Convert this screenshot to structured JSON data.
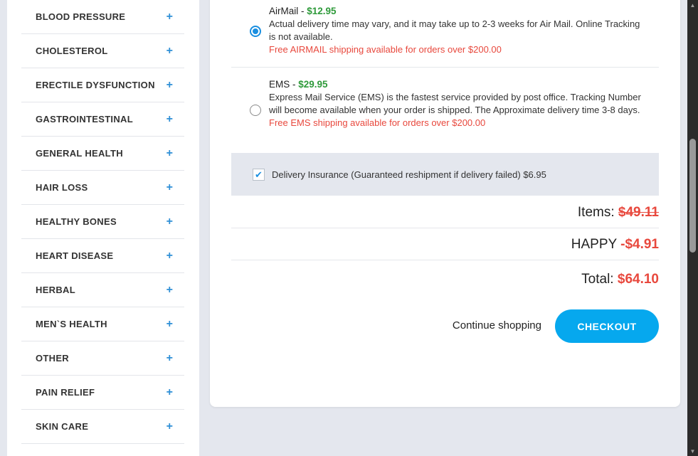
{
  "sidebar": {
    "categories": [
      {
        "label": "BLOOD PRESSURE"
      },
      {
        "label": "CHOLESTEROL"
      },
      {
        "label": "ERECTILE DYSFUNCTION"
      },
      {
        "label": "GASTROINTESTINAL"
      },
      {
        "label": "GENERAL HEALTH"
      },
      {
        "label": "HAIR LOSS"
      },
      {
        "label": "HEALTHY BONES"
      },
      {
        "label": "HEART DISEASE"
      },
      {
        "label": "HERBAL"
      },
      {
        "label": "MEN`S HEALTH"
      },
      {
        "label": "OTHER"
      },
      {
        "label": "PAIN RELIEF"
      },
      {
        "label": "SKIN CARE"
      }
    ],
    "expand_icon": "+"
  },
  "shipping": {
    "airmail": {
      "name": "AirMail",
      "separator": " - ",
      "price": "$12.95",
      "description": "Actual delivery time may vary, and it may take up to 2-3 weeks for Air Mail. Online Tracking is not available.",
      "free_note": "Free AIRMAIL shipping available for orders over $200.00",
      "selected": true
    },
    "ems": {
      "name": "EMS",
      "separator": " - ",
      "price": "$29.95",
      "description": "Express Mail Service (EMS) is the fastest service provided by post office. Tracking Number will become available when your order is shipped. The Approximate delivery time 3-8 days.",
      "free_note": "Free EMS shipping available for orders over $200.00",
      "selected": false
    }
  },
  "insurance": {
    "label": "Delivery Insurance (Guaranteed reshipment if delivery failed) $6.95",
    "checked": true
  },
  "summary": {
    "items_label": "Items:",
    "items_value": "$49.11",
    "coupon_label": "HAPPY",
    "coupon_value": "-$4.91",
    "total_label": "Total:",
    "total_value": "$64.10"
  },
  "actions": {
    "continue_label": "Continue shopping",
    "checkout_label": "CHECKOUT"
  },
  "colors": {
    "accent": "#06a8ee",
    "price_green": "#2e9a3a",
    "alert_red": "#e8483d"
  }
}
